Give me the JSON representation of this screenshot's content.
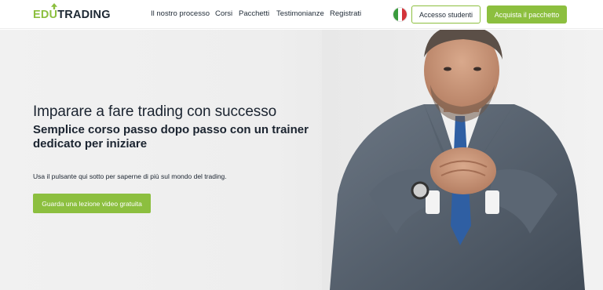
{
  "header": {
    "logo": {
      "part1": "EDU",
      "part2": "TRADING"
    },
    "nav": [
      {
        "label": "Il nostro processo"
      },
      {
        "label": "Corsi"
      },
      {
        "label": "Pacchetti"
      },
      {
        "label": "Testimonianze"
      },
      {
        "label": "Registrati"
      }
    ],
    "language_flag": "flag-italy-icon",
    "student_login_label": "Accesso studenti",
    "buy_package_label": "Acquista il pacchetto"
  },
  "hero": {
    "title": "Imparare a fare trading con successo",
    "subtitle": "Semplice corso passo dopo passo con un trainer dedicato per iniziare",
    "text": "Usa il pulsante qui sotto per saperne di più sul mondo del trading.",
    "cta_label": "Guarda una lezione video gratuita",
    "image": "businessman-portrait"
  },
  "colors": {
    "accent": "#8cbf3f",
    "text": "#1b2430",
    "flag_green": "#3a9b3d",
    "flag_white": "#ffffff",
    "flag_red": "#d3343a"
  }
}
